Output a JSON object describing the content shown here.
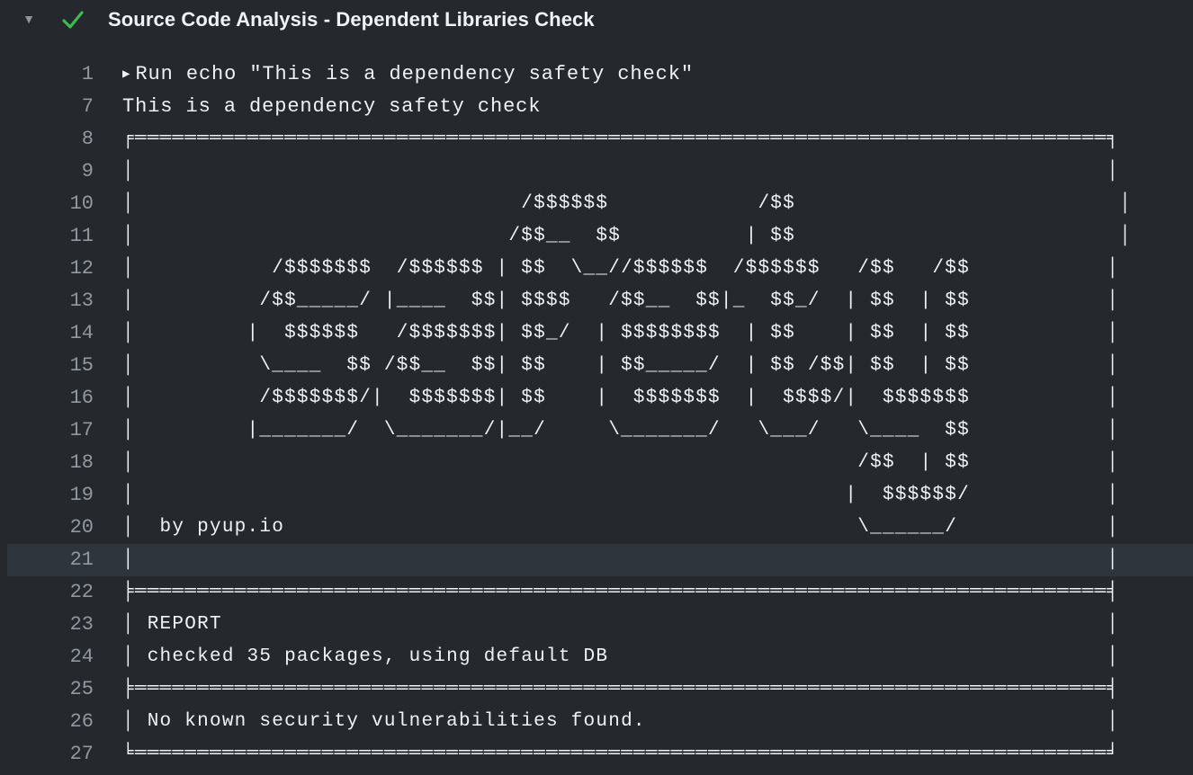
{
  "job": {
    "title": "Source Code Analysis - Dependent Libraries Check",
    "status": "success",
    "status_color": "#3fb950",
    "expanded_icon": "caret-down-icon",
    "status_icon": "check-icon"
  },
  "log": {
    "lines": [
      {
        "num": "1",
        "text": "Run echo \"This is a dependency safety check\""
      },
      {
        "num": "7",
        "text": "This is a dependency safety check"
      },
      {
        "num": "8",
        "text": "╒══════════════════════════════════════════════════════════════════════════════╕"
      },
      {
        "num": "9",
        "text": "│                                                                              │"
      },
      {
        "num": "10",
        "text": "│                               /$$$$$$            /$$                          │"
      },
      {
        "num": "11",
        "text": "│                              /$$__  $$          | $$                          │"
      },
      {
        "num": "12",
        "text": "│           /$$$$$$$  /$$$$$$ | $$  \\__//$$$$$$  /$$$$$$   /$$   /$$           │"
      },
      {
        "num": "13",
        "text": "│          /$$_____/ |____  $$| $$$$   /$$__  $$|_  $$_/  | $$  | $$           │"
      },
      {
        "num": "14",
        "text": "│         |  $$$$$$   /$$$$$$$| $$_/  | $$$$$$$$  | $$    | $$  | $$           │"
      },
      {
        "num": "15",
        "text": "│          \\____  $$ /$$__  $$| $$    | $$_____/  | $$ /$$| $$  | $$           │"
      },
      {
        "num": "16",
        "text": "│          /$$$$$$$/|  $$$$$$$| $$    |  $$$$$$$  |  $$$$/|  $$$$$$$           │"
      },
      {
        "num": "17",
        "text": "│         |_______/  \\_______/|__/     \\_______/   \\___/   \\____  $$           │"
      },
      {
        "num": "18",
        "text": "│                                                          /$$  | $$           │"
      },
      {
        "num": "19",
        "text": "│                                                         |  $$$$$$/           │"
      },
      {
        "num": "20",
        "text": "│  by pyup.io                                              \\______/            │"
      },
      {
        "num": "21",
        "text": "│                                                                              │"
      },
      {
        "num": "22",
        "text": "╞══════════════════════════════════════════════════════════════════════════════╡"
      },
      {
        "num": "23",
        "text": "│ REPORT                                                                       │"
      },
      {
        "num": "24",
        "text": "│ checked 35 packages, using default DB                                        │"
      },
      {
        "num": "25",
        "text": "╞══════════════════════════════════════════════════════════════════════════════╡"
      },
      {
        "num": "26",
        "text": "│ No known security vulnerabilities found.                                     │"
      },
      {
        "num": "27",
        "text": "╘══════════════════════════════════════════════════════════════════════════════╛"
      }
    ],
    "highlighted_line": "21"
  }
}
